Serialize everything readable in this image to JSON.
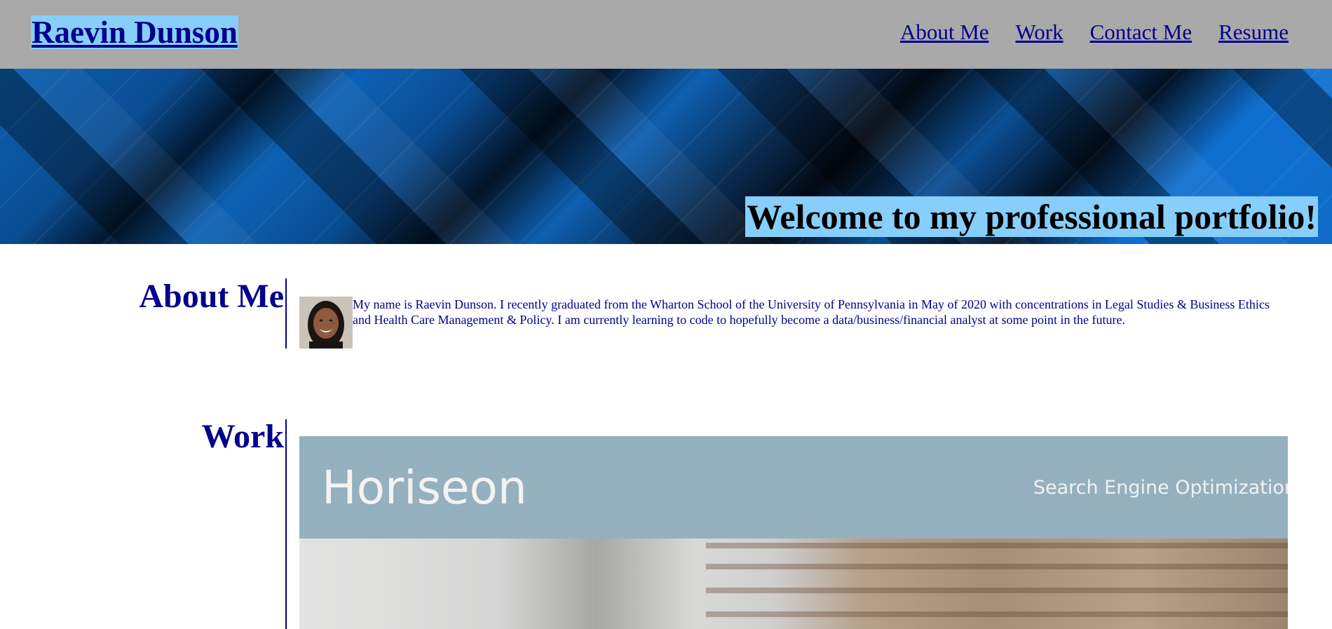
{
  "header": {
    "brand": "Raevin Dunson",
    "nav": [
      "About Me",
      "Work",
      "Contact Me",
      "Resume"
    ]
  },
  "hero": {
    "title": "Welcome to my professional portfolio!"
  },
  "about": {
    "heading": "About Me",
    "text": "My name is Raevin Dunson. I recently graduated from the Wharton School of the University of Pennsylvania in May of 2020 with concentrations in Legal Studies & Business Ethics and Health Care Management & Policy. I am currently learning to code to hopefully become a data/business/financial analyst at some point in the future."
  },
  "work": {
    "heading": "Work",
    "project": {
      "logo": "Horiseon",
      "tagline": "Search Engine Optimization"
    }
  },
  "colors": {
    "header_bg": "#a9a9a9",
    "accent_text": "#00008b",
    "highlight": "#87cefa"
  }
}
